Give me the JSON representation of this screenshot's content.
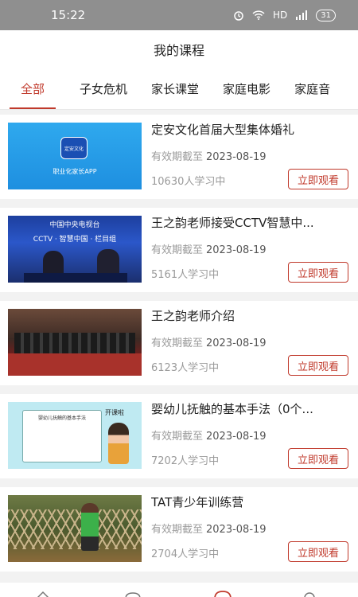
{
  "status_bar": {
    "time": "15:22",
    "network": "HD",
    "battery": "31"
  },
  "header": {
    "title": "我的课程"
  },
  "tabs": [
    {
      "label": "全部",
      "active": true
    },
    {
      "label": "子女危机",
      "active": false
    },
    {
      "label": "家长课堂",
      "active": false
    },
    {
      "label": "家庭电影",
      "active": false
    },
    {
      "label": "家庭音",
      "active": false
    }
  ],
  "courses": [
    {
      "title": "定安文化首届大型集体婚礼",
      "expiry_label": "有效期截至",
      "expiry_date": "2023-08-19",
      "learners": "10630人学习中",
      "button": "立即观看",
      "thumb_caption": "职业化家长APP",
      "thumb_logo": "定安文化"
    },
    {
      "title": "王之韵老师接受CCTV智慧中...",
      "expiry_label": "有效期截至",
      "expiry_date": "2023-08-19",
      "learners": "5161人学习中",
      "button": "立即观看",
      "thumb_caption": "中国中央电视台",
      "thumb_caption2": "CCTV · 智慧中国 · 栏目组"
    },
    {
      "title": "王之韵老师介绍",
      "expiry_label": "有效期截至",
      "expiry_date": "2023-08-19",
      "learners": "6123人学习中",
      "button": "立即观看"
    },
    {
      "title": "婴幼儿抚触的基本手法（0个...",
      "expiry_label": "有效期截至",
      "expiry_date": "2023-08-19",
      "learners": "7202人学习中",
      "button": "立即观看",
      "thumb_caption": "婴幼儿抚触的基本手法",
      "thumb_caption2": "开课啦"
    },
    {
      "title": "TAT青少年训练营",
      "expiry_label": "有效期截至",
      "expiry_date": "2023-08-19",
      "learners": "2704人学习中",
      "button": "立即观看"
    }
  ],
  "colors": {
    "accent": "#c0392b",
    "status_bar": "#8f8f8f"
  }
}
